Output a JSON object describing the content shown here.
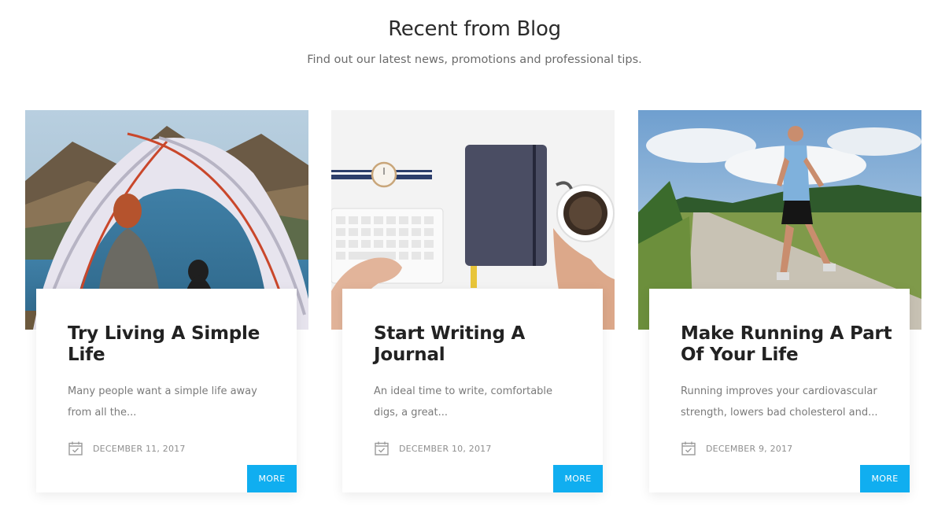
{
  "section": {
    "title": "Recent from Blog",
    "subtitle": "Find out our latest news, promotions and professional tips."
  },
  "posts": [
    {
      "title": "Try Living A Simple Life",
      "excerpt": "Many people want a simple life away from all the...",
      "date": "DECEMBER 11, 2017",
      "more_label": "MORE",
      "image": "camping-tent-lake-photo"
    },
    {
      "title": "Start Writing A Journal",
      "excerpt": "An ideal time to write, comfortable digs, a great...",
      "date": "DECEMBER 10, 2017",
      "more_label": "MORE",
      "image": "desk-notebook-coffee-photo"
    },
    {
      "title": "Make Running A Part Of Your Life",
      "excerpt": "Running improves your cardiovascular strength, lowers bad cholesterol and...",
      "date": "DECEMBER 9, 2017",
      "more_label": "MORE",
      "image": "runner-country-road-photo"
    }
  ],
  "colors": {
    "accent": "#10aef0",
    "title": "#222222",
    "text": "#7a7a7a",
    "meta": "#8f8f8f"
  },
  "icons": {
    "date": "calendar-icon"
  }
}
